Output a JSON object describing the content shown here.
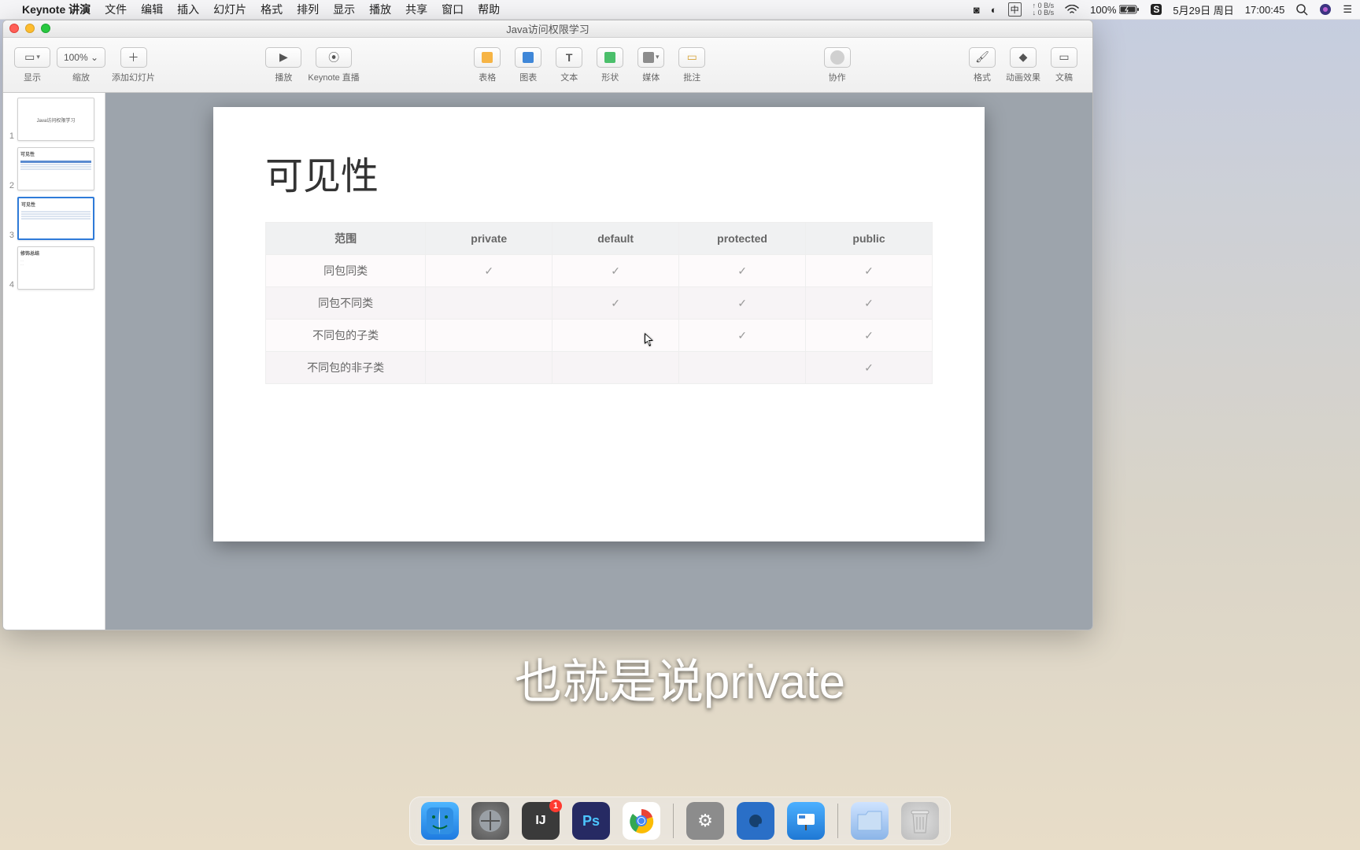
{
  "menubar": {
    "app": "Keynote 讲演",
    "items": [
      "文件",
      "编辑",
      "插入",
      "幻灯片",
      "格式",
      "排列",
      "显示",
      "播放",
      "共享",
      "窗口",
      "帮助"
    ],
    "status": {
      "net_up": "↑ 0 B/s",
      "net_down": "↓ 0 B/s",
      "battery": "100%",
      "date": "5月29日 周日",
      "time": "17:00:45"
    }
  },
  "window": {
    "title": "Java访问权限学习"
  },
  "toolbar": {
    "view": "显示",
    "zoom": "100% ⌄",
    "zoom_lbl": "缩放",
    "add": "添加幻灯片",
    "play": "播放",
    "live": "Keynote 直播",
    "table": "表格",
    "chart": "图表",
    "text": "文本",
    "shape": "形状",
    "media": "媒体",
    "comment": "批注",
    "collab": "协作",
    "format": "格式",
    "animate": "动画效果",
    "document": "文稿"
  },
  "slides": {
    "numbers": [
      "1",
      "2",
      "3",
      "4"
    ]
  },
  "slide": {
    "title": "可见性",
    "table": {
      "headers": [
        "范围",
        "private",
        "default",
        "protected",
        "public"
      ],
      "rows": [
        {
          "label": "同包同类",
          "cells": [
            "✓",
            "✓",
            "✓",
            "✓"
          ]
        },
        {
          "label": "同包不同类",
          "cells": [
            "",
            "✓",
            "✓",
            "✓"
          ]
        },
        {
          "label": "不同包的子类",
          "cells": [
            "",
            "",
            "✓",
            "✓"
          ]
        },
        {
          "label": "不同包的非子类",
          "cells": [
            "",
            "",
            "",
            "✓"
          ]
        }
      ]
    }
  },
  "chart_data": {
    "type": "table",
    "title": "可见性",
    "columns": [
      "范围",
      "private",
      "default",
      "protected",
      "public"
    ],
    "rows": [
      [
        "同包同类",
        true,
        true,
        true,
        true
      ],
      [
        "同包不同类",
        false,
        true,
        true,
        true
      ],
      [
        "不同包的子类",
        false,
        false,
        true,
        true
      ],
      [
        "不同包的非子类",
        false,
        false,
        false,
        true
      ]
    ]
  },
  "subtitle": "也就是说private",
  "dock": {
    "intellij_badge": "1"
  }
}
